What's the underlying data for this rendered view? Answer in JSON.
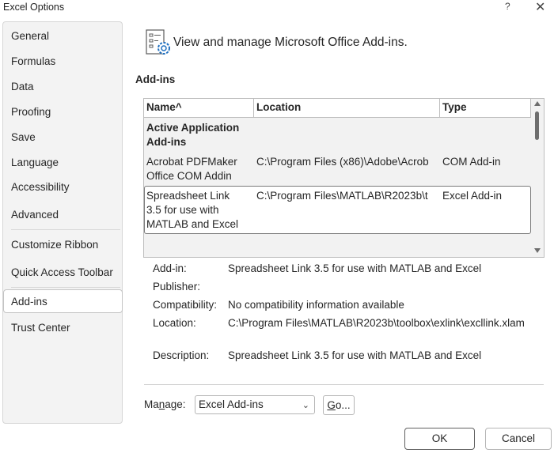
{
  "window": {
    "title": "Excel Options",
    "help_glyph": "?",
    "close_glyph": "✕"
  },
  "sidebar": {
    "items": [
      {
        "label": "General"
      },
      {
        "label": "Formulas"
      },
      {
        "label": "Data"
      },
      {
        "label": "Proofing"
      },
      {
        "label": "Save"
      },
      {
        "label": "Language"
      },
      {
        "label": "Accessibility"
      },
      {
        "label": "Advanced"
      },
      {
        "label": "Customize Ribbon"
      },
      {
        "label": "Quick Access Toolbar"
      },
      {
        "label": "Add-ins",
        "selected": true
      },
      {
        "label": "Trust Center"
      }
    ]
  },
  "main": {
    "header_text": "View and manage Microsoft Office Add-ins.",
    "header_icon": "addins-gear-icon",
    "section_title": "Add-ins",
    "list": {
      "columns": [
        "Name^",
        "Location",
        "Type"
      ],
      "group": {
        "line1": "Active Application",
        "line2": "Add-ins"
      },
      "rows": [
        {
          "name1": "Acrobat PDFMaker",
          "name2": "Office COM Addin",
          "name3": "",
          "location": "C:\\Program Files (x86)\\Adobe\\Acrob",
          "type": "COM Add-in"
        },
        {
          "name1": "Spreadsheet Link",
          "name2": "3.5 for use with",
          "name3": "MATLAB and Excel",
          "location": "C:\\Program Files\\MATLAB\\R2023b\\t",
          "type": "Excel Add-in",
          "selected": true
        }
      ]
    },
    "details": {
      "addin_label": "Add-in:",
      "addin_value": "Spreadsheet Link 3.5 for use with MATLAB and Excel",
      "publisher_label": "Publisher:",
      "publisher_value": "",
      "compat_label": "Compatibility:",
      "compat_value": "No compatibility information available",
      "location_label": "Location:",
      "location_value": "C:\\Program Files\\MATLAB\\R2023b\\toolbox\\exlink\\excllink.xlam",
      "description_label": "Description:",
      "description_value": "Spreadsheet Link 3.5 for use with MATLAB and Excel"
    },
    "manage": {
      "label_pre": "Ma",
      "label_accel": "n",
      "label_post": "age:",
      "selected": "Excel Add-ins",
      "go_accel": "G",
      "go_post": "o..."
    }
  },
  "footer": {
    "ok_label": "OK",
    "cancel_label": "Cancel"
  },
  "colors": {
    "sidebar_bg": "#f3f3f3",
    "list_bg": "#f2f2f2",
    "border": "#bdbdbd"
  }
}
